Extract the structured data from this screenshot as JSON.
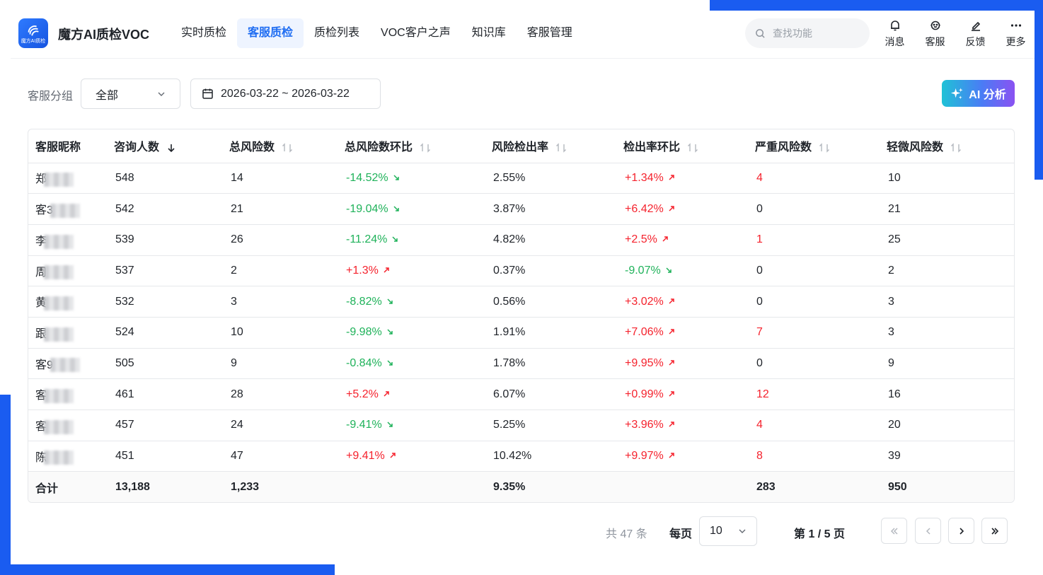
{
  "app": {
    "logo_text": "魔方AI质检",
    "title": "魔方AI质检VOC"
  },
  "nav": [
    {
      "label": "实时质检",
      "active": false
    },
    {
      "label": "客服质检",
      "active": true
    },
    {
      "label": "质检列表",
      "active": false
    },
    {
      "label": "VOC客户之声",
      "active": false
    },
    {
      "label": "知识库",
      "active": false
    },
    {
      "label": "客服管理",
      "active": false
    }
  ],
  "search": {
    "placeholder": "查找功能"
  },
  "tools": [
    {
      "label": "消息",
      "icon": "bell-icon"
    },
    {
      "label": "客服",
      "icon": "customer-service-icon"
    },
    {
      "label": "反馈",
      "icon": "edit-icon"
    },
    {
      "label": "更多",
      "icon": "more-icon"
    }
  ],
  "filters": {
    "group_label": "客服分组",
    "group_value": "全部",
    "date_range": "2026-03-22 ~ 2026-03-22",
    "ai_button": "AI 分析"
  },
  "table": {
    "columns": [
      "客服昵称",
      "咨询人数",
      "总风险数",
      "总风险数环比",
      "风险检出率",
      "检出率环比",
      "严重风险数",
      "轻微风险数"
    ],
    "rows": [
      {
        "name": "郑",
        "consults": "548",
        "total_risk": "14",
        "risk_mom": "-14.52%",
        "risk_mom_dir": "down",
        "rate": "2.55%",
        "rate_mom": "+1.34%",
        "rate_mom_dir": "up",
        "severe": "4",
        "severe_red": true,
        "minor": "10"
      },
      {
        "name": "客3",
        "consults": "542",
        "total_risk": "21",
        "risk_mom": "-19.04%",
        "risk_mom_dir": "down",
        "rate": "3.87%",
        "rate_mom": "+6.42%",
        "rate_mom_dir": "up",
        "severe": "0",
        "severe_red": false,
        "minor": "21"
      },
      {
        "name": "李",
        "consults": "539",
        "total_risk": "26",
        "risk_mom": "-11.24%",
        "risk_mom_dir": "down",
        "rate": "4.82%",
        "rate_mom": "+2.5%",
        "rate_mom_dir": "up",
        "severe": "1",
        "severe_red": true,
        "minor": "25"
      },
      {
        "name": "周",
        "consults": "537",
        "total_risk": "2",
        "risk_mom": "+1.3%",
        "risk_mom_dir": "up",
        "rate": "0.37%",
        "rate_mom": "-9.07%",
        "rate_mom_dir": "down",
        "severe": "0",
        "severe_red": false,
        "minor": "2"
      },
      {
        "name": "黄",
        "consults": "532",
        "total_risk": "3",
        "risk_mom": "-8.82%",
        "risk_mom_dir": "down",
        "rate": "0.56%",
        "rate_mom": "+3.02%",
        "rate_mom_dir": "up",
        "severe": "0",
        "severe_red": false,
        "minor": "3"
      },
      {
        "name": "跟",
        "consults": "524",
        "total_risk": "10",
        "risk_mom": "-9.98%",
        "risk_mom_dir": "down",
        "rate": "1.91%",
        "rate_mom": "+7.06%",
        "rate_mom_dir": "up",
        "severe": "7",
        "severe_red": true,
        "minor": "3"
      },
      {
        "name": "客9",
        "consults": "505",
        "total_risk": "9",
        "risk_mom": "-0.84%",
        "risk_mom_dir": "down",
        "rate": "1.78%",
        "rate_mom": "+9.95%",
        "rate_mom_dir": "up",
        "severe": "0",
        "severe_red": false,
        "minor": "9"
      },
      {
        "name": "客",
        "consults": "461",
        "total_risk": "28",
        "risk_mom": "+5.2%",
        "risk_mom_dir": "up",
        "rate": "6.07%",
        "rate_mom": "+0.99%",
        "rate_mom_dir": "up",
        "severe": "12",
        "severe_red": true,
        "minor": "16"
      },
      {
        "name": "客",
        "consults": "457",
        "total_risk": "24",
        "risk_mom": "-9.41%",
        "risk_mom_dir": "down",
        "rate": "5.25%",
        "rate_mom": "+3.96%",
        "rate_mom_dir": "up",
        "severe": "4",
        "severe_red": true,
        "minor": "20"
      },
      {
        "name": "陈",
        "consults": "451",
        "total_risk": "47",
        "risk_mom": "+9.41%",
        "risk_mom_dir": "up",
        "rate": "10.42%",
        "rate_mom": "+9.97%",
        "rate_mom_dir": "up",
        "severe": "8",
        "severe_red": true,
        "minor": "39"
      }
    ],
    "total": {
      "label": "合计",
      "consults": "13,188",
      "total_risk": "1,233",
      "rate": "9.35%",
      "severe": "283",
      "minor": "950"
    }
  },
  "pagination": {
    "total_text": "共 47 条",
    "per_page_label": "每页",
    "per_page_value": "10",
    "page_info": "第 1 / 5 页"
  },
  "colors": {
    "primary": "#1f6df2",
    "up": "#f5222d",
    "down": "#1fb25a",
    "accent_frame": "#1a5cf0"
  }
}
